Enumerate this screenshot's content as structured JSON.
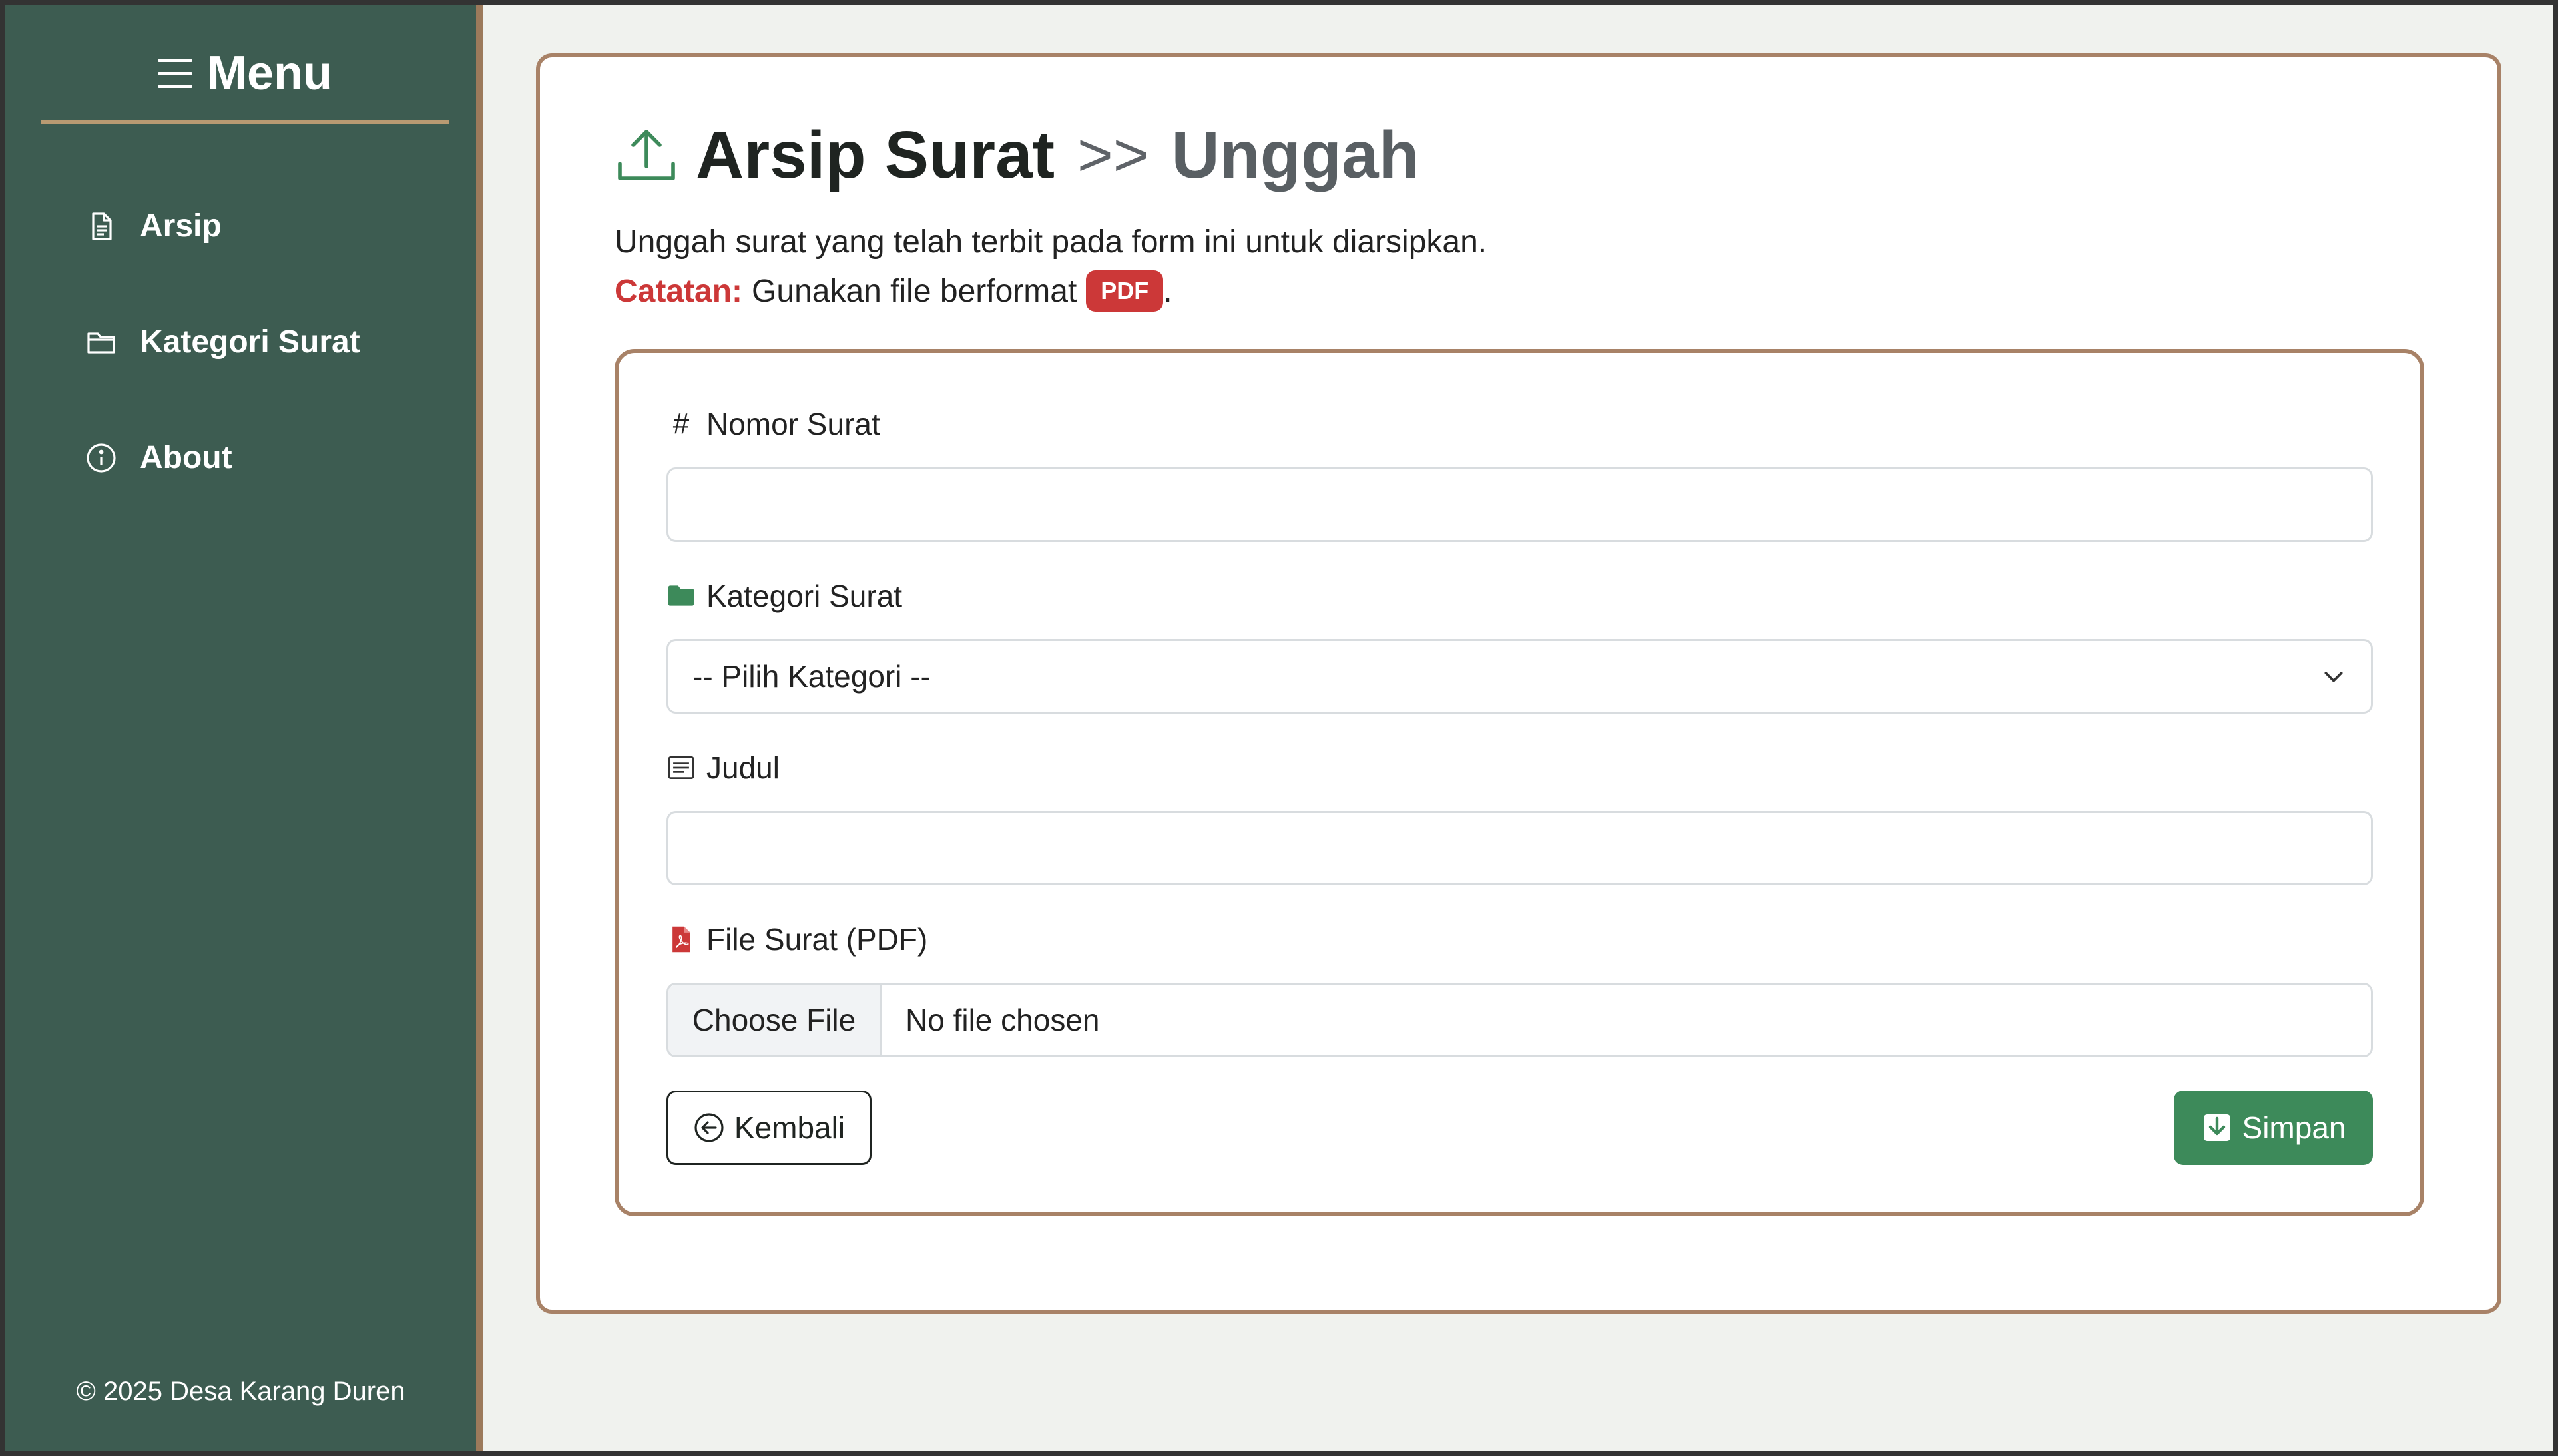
{
  "sidebar": {
    "title": "Menu",
    "items": [
      {
        "label": "Arsip",
        "icon": "file-text-icon"
      },
      {
        "label": "Kategori Surat",
        "icon": "folder-icon"
      },
      {
        "label": "About",
        "icon": "info-icon"
      }
    ],
    "footer": "© 2025 Desa Karang Duren"
  },
  "page": {
    "title": "Arsip Surat",
    "separator": ">>",
    "subtitle": "Unggah",
    "description": "Unggah surat yang telah terbit pada form ini untuk diarsipkan.",
    "note_label": "Catatan:",
    "note_text": "Gunakan file berformat",
    "note_badge": "PDF",
    "note_end": "."
  },
  "form": {
    "nomor_label": "Nomor Surat",
    "nomor_value": "",
    "kategori_label": "Kategori Surat",
    "kategori_selected": "-- Pilih Kategori --",
    "judul_label": "Judul",
    "judul_value": "",
    "file_label": "File Surat (PDF)",
    "file_button": "Choose File",
    "file_status": "No file chosen",
    "back_label": "Kembali",
    "save_label": "Simpan"
  },
  "colors": {
    "sidebar_bg": "#3d5c51",
    "accent_border": "#a88267",
    "primary_green": "#3d8a5a",
    "danger_red": "#cc3838"
  }
}
